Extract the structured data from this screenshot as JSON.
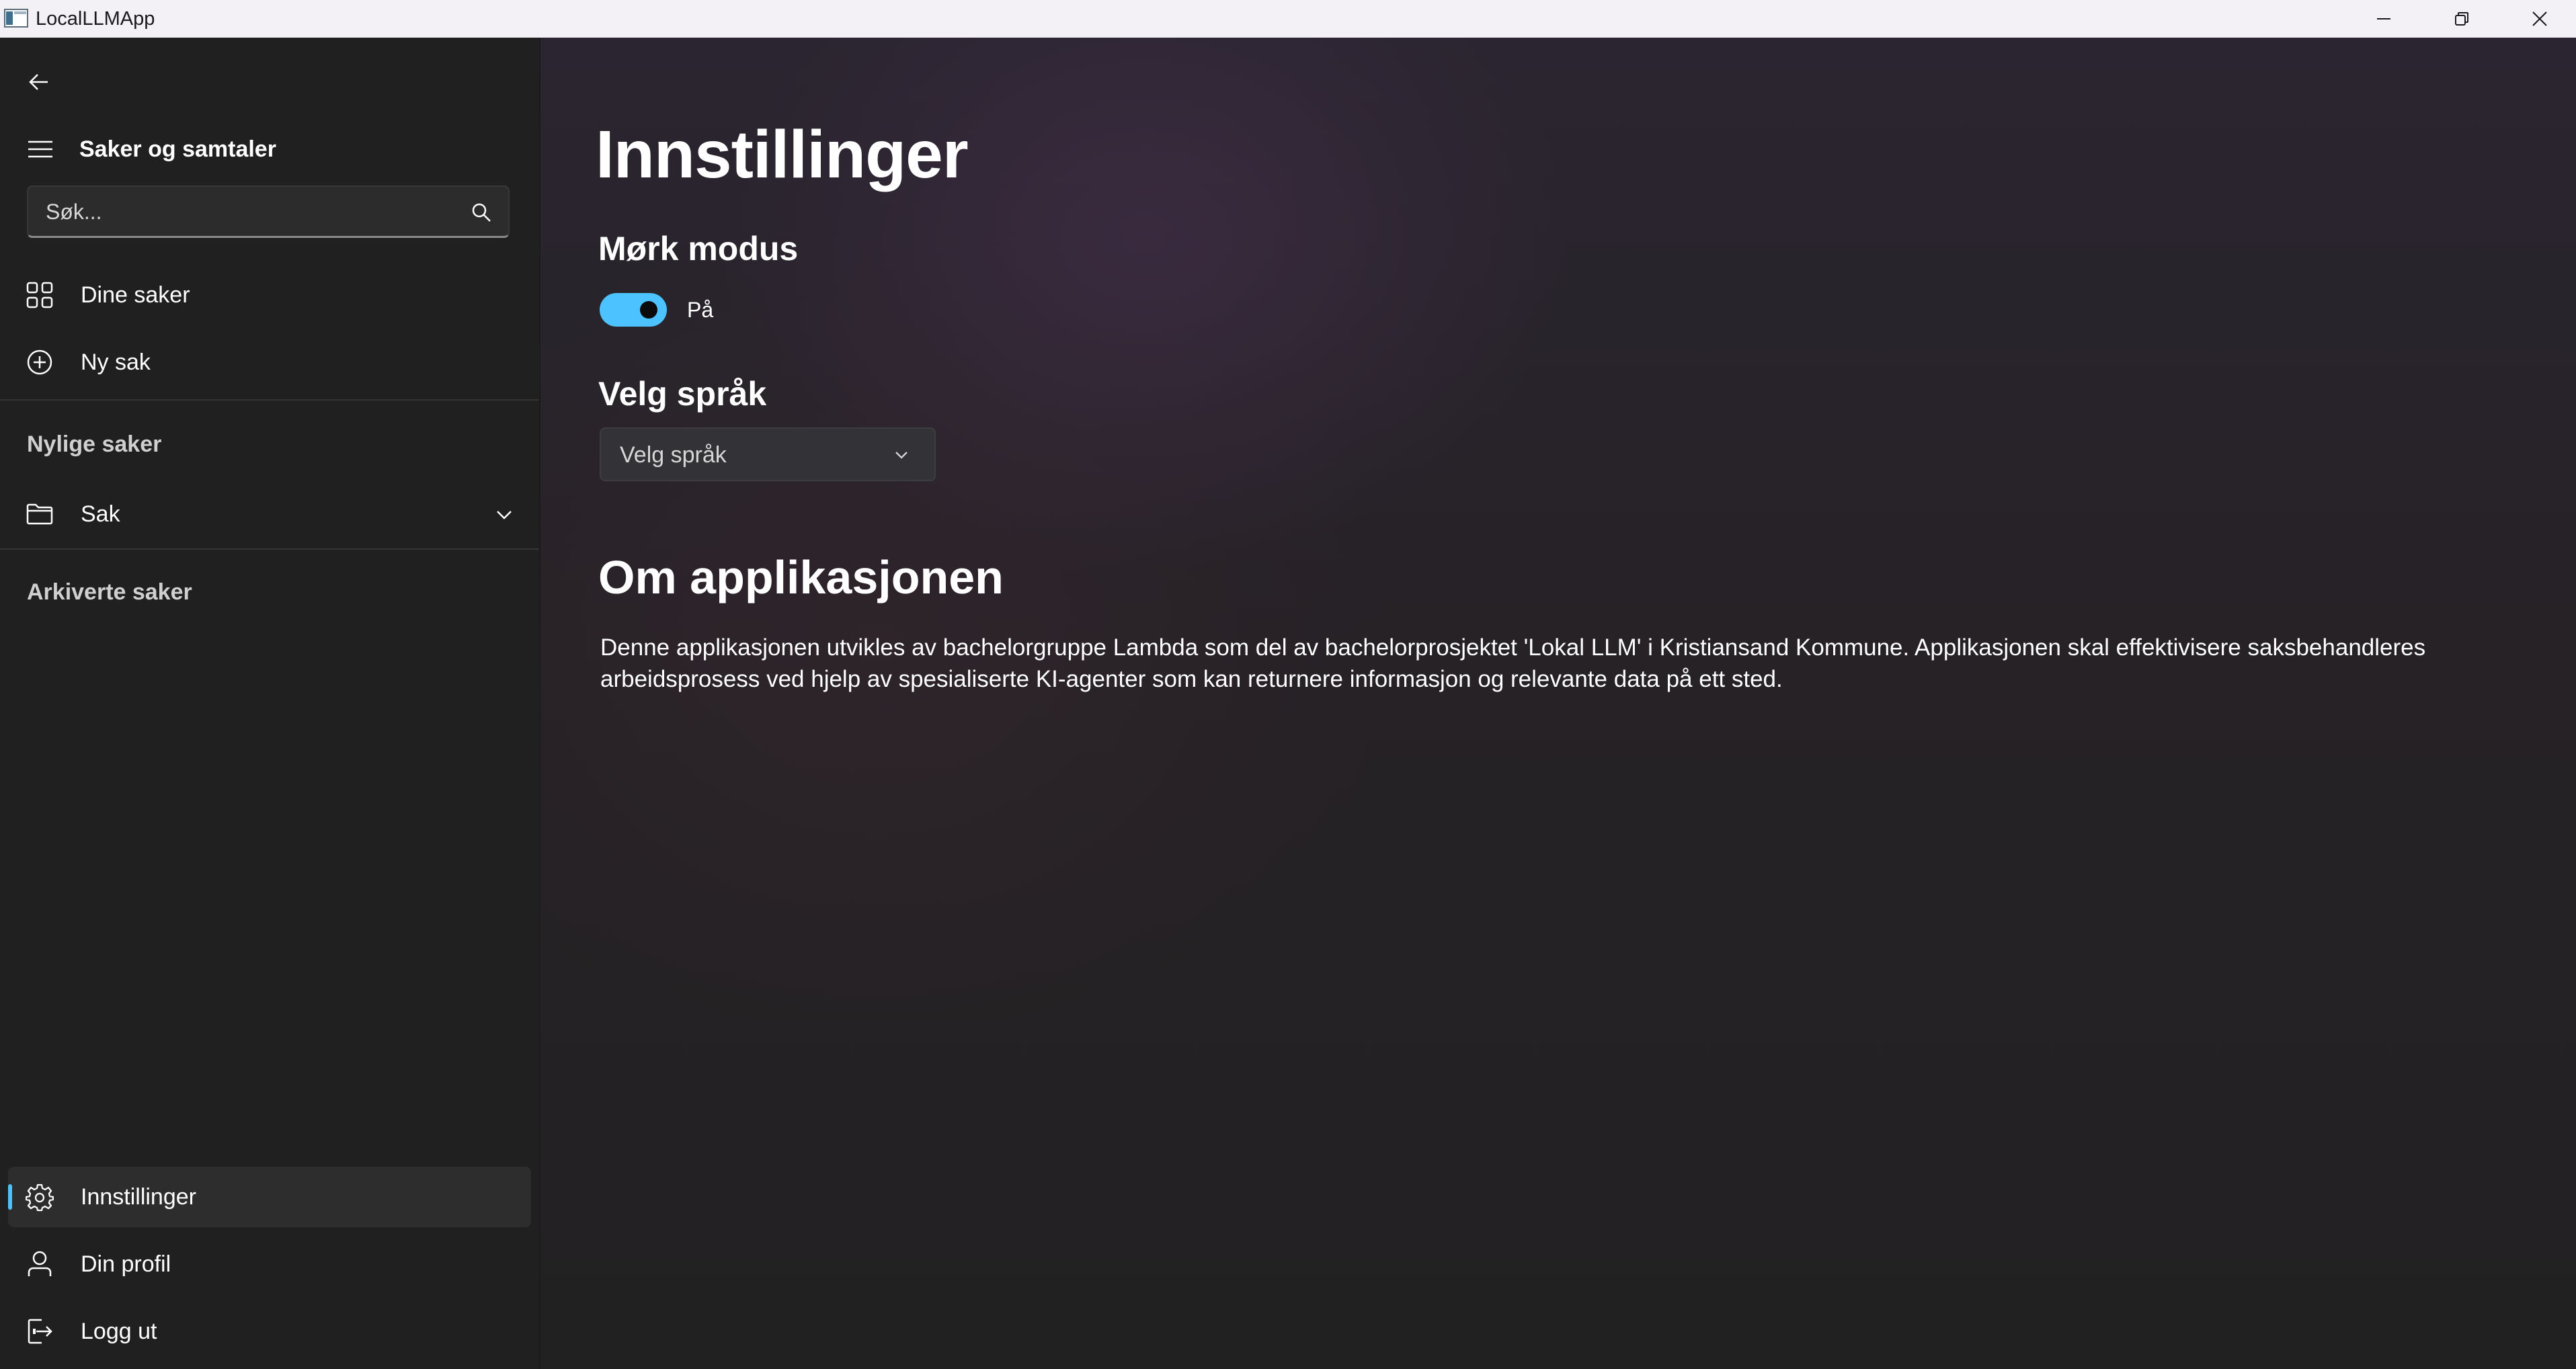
{
  "window": {
    "title": "LocalLLMApp"
  },
  "sidebar": {
    "pane_title": "Saker og samtaler",
    "search": {
      "placeholder": "Søk..."
    },
    "nav_items": [
      {
        "label": "Dine saker",
        "icon": "grid-icon"
      },
      {
        "label": "Ny sak",
        "icon": "plus-circle-icon"
      }
    ],
    "recent_header": "Nylige saker",
    "recent_items": [
      {
        "label": "Sak",
        "icon": "folder-icon",
        "expandable": true
      }
    ],
    "archived_header": "Arkiverte saker",
    "footer_items": [
      {
        "label": "Innstillinger",
        "icon": "gear-icon",
        "selected": true
      },
      {
        "label": "Din profil",
        "icon": "person-icon"
      },
      {
        "label": "Logg ut",
        "icon": "sign-out-icon"
      }
    ],
    "accent_color": "#4cc2ff"
  },
  "main": {
    "title": "Innstillinger",
    "dark_mode": {
      "heading": "Mørk modus",
      "state_label": "På",
      "enabled": true
    },
    "language": {
      "heading": "Velg språk",
      "selected": "Velg språk"
    },
    "about": {
      "heading": "Om applikasjonen",
      "text": "Denne applikasjonen utvikles av bachelorgruppe Lambda som del av bachelorprosjektet 'Lokal LLM' i Kristiansand Kommune. Applikasjonen skal effektivisere saksbehandleres arbeidsprosess ved hjelp av spesialiserte KI-agenter som kan returnere informasjon og relevante data på ett sted."
    }
  }
}
